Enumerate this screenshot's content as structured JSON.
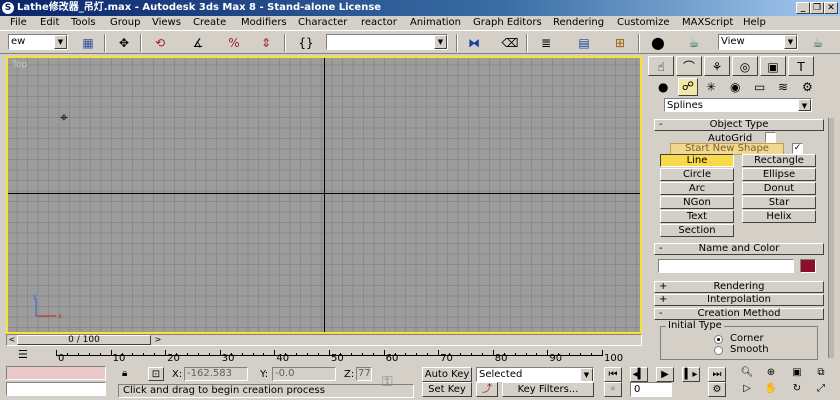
{
  "titlebar": {
    "app_icon": "3ds-max-logo",
    "title": "Lathe修改器_吊灯.max - Autodesk 3ds Max 8  - Stand-alone License",
    "buttons": {
      "minimize": "_",
      "restore": "❐",
      "close": "✕"
    }
  },
  "menu": [
    "File",
    "Edit",
    "Tools",
    "Group",
    "Views",
    "Create",
    "Modifiers",
    "Character",
    "reactor",
    "Animation",
    "Graph Editors",
    "Rendering",
    "Customize",
    "MAXScript",
    "Help"
  ],
  "toolbar": {
    "selection_filter": "ew",
    "named_selection": "",
    "view_dropdown": "View"
  },
  "viewport": {
    "label": "Top",
    "grid_color": "#9c9c9c",
    "border_color": "#f7e332"
  },
  "timeline": {
    "slider_text": "0 / 100",
    "prev_arrow": "<",
    "next_arrow": ">",
    "ticks": [
      "0",
      "10",
      "20",
      "30",
      "40",
      "50",
      "60",
      "70",
      "80",
      "90",
      "100"
    ]
  },
  "status": {
    "prompt": "Click and drag to begin creation process",
    "x_label": "X:",
    "x_value": "-162.583",
    "y_label": "Y:",
    "y_value": "-0.0",
    "z_label": "Z:",
    "z_value": "77",
    "auto_key": "Auto Key",
    "set_key": "Set Key",
    "selected_dropdown": "Selected",
    "key_filters": "Key Filters...",
    "frame_value": "0"
  },
  "command_panel": {
    "category_dropdown": "Splines",
    "object_type": {
      "header": "Object Type",
      "autogrid_label": "AutoGrid",
      "autogrid_checked": false,
      "start_new_shape": "Start New Shape",
      "start_new_shape_checked": true,
      "buttons": [
        "Line",
        "Rectangle",
        "Circle",
        "Ellipse",
        "Arc",
        "Donut",
        "NGon",
        "Star",
        "Text",
        "Helix",
        "Section"
      ],
      "active": "Line"
    },
    "name_and_color": {
      "header": "Name and Color",
      "name_value": "",
      "color": "#8c0f2a"
    },
    "rendering": {
      "sign": "+",
      "header": "Rendering"
    },
    "interpolation": {
      "sign": "+",
      "header": "Interpolation"
    },
    "creation_method": {
      "sign": "-",
      "header": "Creation Method",
      "initial_type_label": "Initial Type",
      "options": [
        "Corner",
        "Smooth"
      ],
      "selected": "Corner"
    },
    "object_type_sign": "-",
    "name_color_sign": "-"
  }
}
